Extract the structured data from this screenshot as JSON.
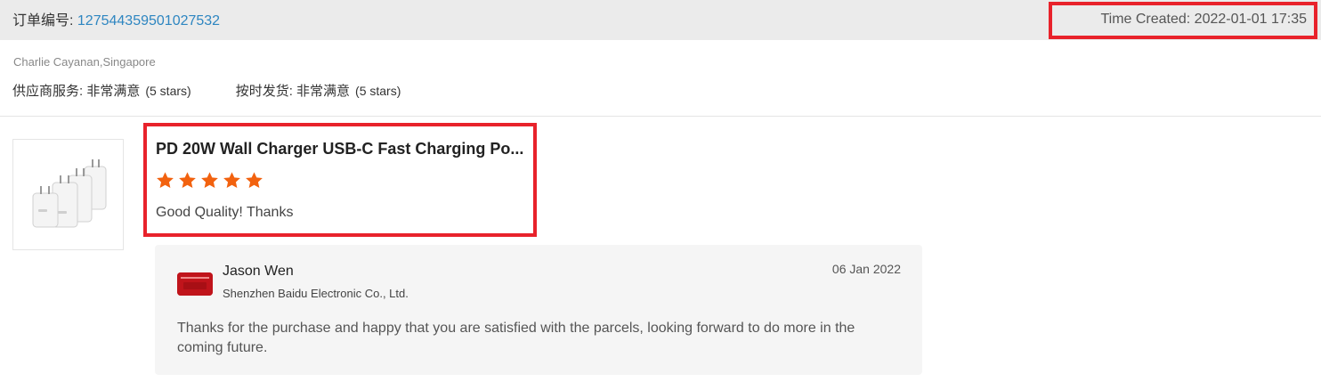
{
  "order": {
    "label": "订单编号: ",
    "number": "127544359501027532",
    "time_created": "Time Created: 2022-01-01 17:35"
  },
  "buyer": {
    "name_location": "Charlie Cayanan,Singapore"
  },
  "ratings": [
    {
      "label": "供应商服务: 非常满意",
      "stars_text": "(5 stars)"
    },
    {
      "label": "按时发货: 非常满意",
      "stars_text": "(5 stars)"
    }
  ],
  "product": {
    "title": "PD 20W Wall Charger USB-C Fast Charging Po...",
    "rating": 5,
    "star_color": "#f2620f",
    "review": "Good Quality! Thanks",
    "image_icon": "charger-product-icon"
  },
  "reply": {
    "seller_name": "Jason Wen",
    "company": "Shenzhen Baidu Electronic Co., Ltd.",
    "date": "06 Jan 2022",
    "text": "Thanks for the purchase and happy that you are satisfied with the parcels, looking forward to do more in the coming future."
  },
  "colors": {
    "highlight_border": "#e8222b",
    "link": "#2e86c1",
    "header_bg": "#ebebeb"
  }
}
